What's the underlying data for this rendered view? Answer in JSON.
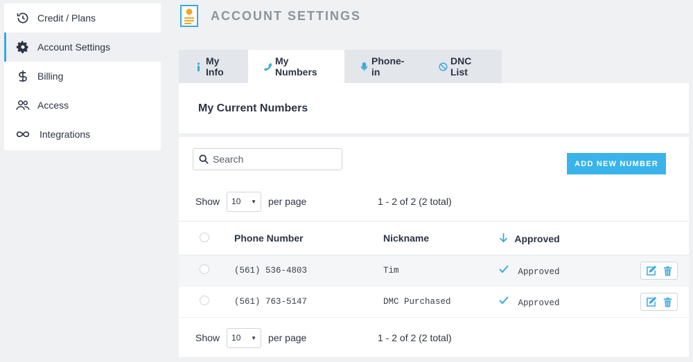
{
  "sidebar": {
    "items": [
      {
        "label": "Credit / Plans",
        "icon": "history-icon"
      },
      {
        "label": "Account Settings",
        "icon": "gear-icon"
      },
      {
        "label": "Billing",
        "icon": "dollar-icon"
      },
      {
        "label": "Access",
        "icon": "users-icon"
      },
      {
        "label": "Integrations",
        "icon": "infinity-icon"
      }
    ],
    "active_index": 1
  },
  "header": {
    "title": "ACCOUNT SETTINGS",
    "icon": "document-icon"
  },
  "tabs": [
    {
      "label": "My Info",
      "icon": "info-icon"
    },
    {
      "label": "My Numbers",
      "icon": "phone-icon"
    },
    {
      "label": "Phone-in",
      "icon": "microphone-icon"
    },
    {
      "label": "DNC List",
      "icon": "ban-icon"
    }
  ],
  "active_tab": 1,
  "section_title": "My Current Numbers",
  "search": {
    "placeholder": "Search",
    "value": ""
  },
  "add_button_label": "ADD NEW NUMBER",
  "pager": {
    "show_label": "Show",
    "per_page_value": "10",
    "per_page_label": "per page",
    "count_text": "1 - 2 of 2 (2 total)"
  },
  "table": {
    "columns": [
      "Phone Number",
      "Nickname",
      "Approved"
    ],
    "rows": [
      {
        "phone": "(561) 536-4803",
        "nickname": "Tim",
        "status": "Approved"
      },
      {
        "phone": "(561) 763-5147",
        "nickname": "DMC Purchased",
        "status": "Approved"
      }
    ]
  },
  "colors": {
    "accent": "#3ab3ea",
    "background": "#f0f1f3"
  }
}
